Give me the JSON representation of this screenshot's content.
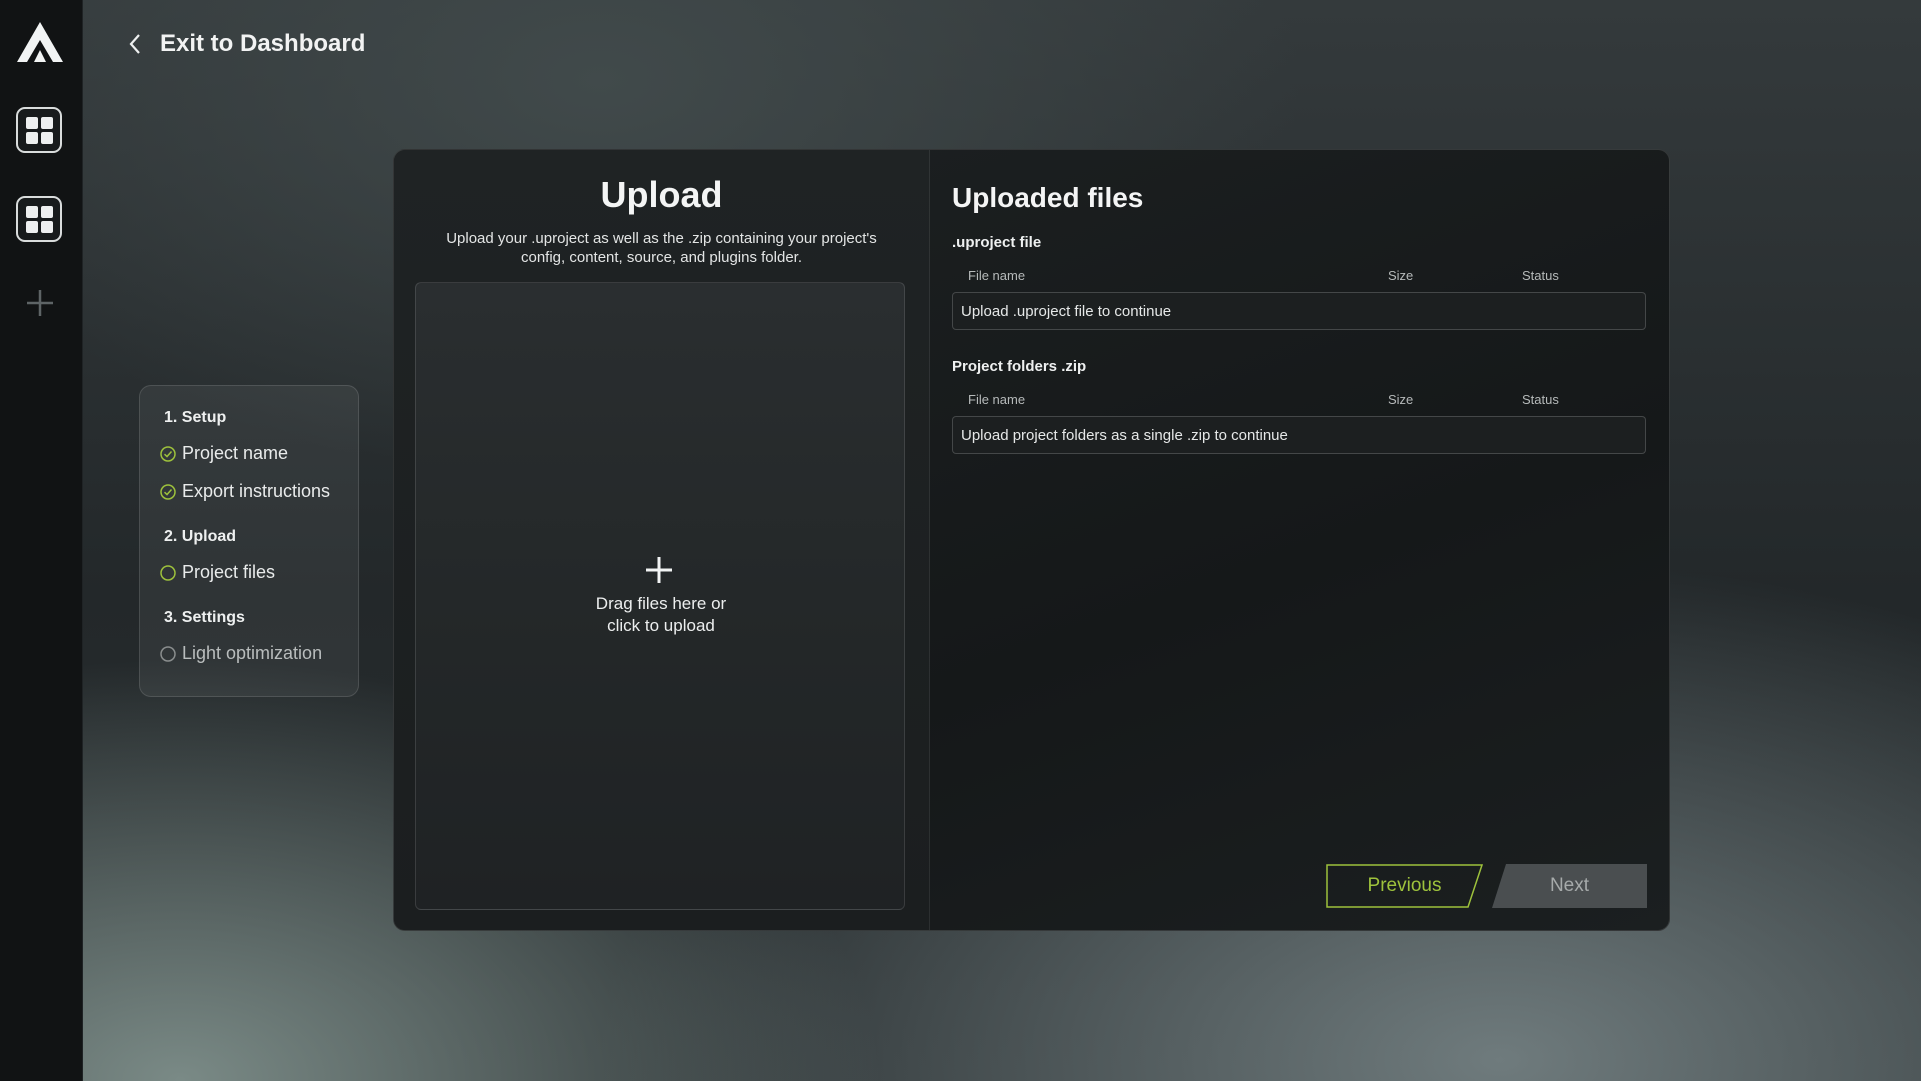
{
  "nav": {
    "back_label": "Exit to Dashboard"
  },
  "steps": {
    "setup": "1. Setup",
    "project_name": "Project name",
    "export_instructions": "Export instructions",
    "upload": "2. Upload",
    "project_files": "Project files",
    "settings": "3. Settings",
    "light_optimization": "Light optimization"
  },
  "upload": {
    "title": "Upload",
    "description": "Upload your .uproject as well as the .zip containing your project's config, content, source, and plugins folder.",
    "drop_line1": "Drag files here or",
    "drop_line2": "click to upload"
  },
  "files": {
    "title": "Uploaded files",
    "uproject": {
      "label": ".uproject file",
      "col_name": "File name",
      "col_size": "Size",
      "col_status": "Status",
      "empty": "Upload .uproject file to continue"
    },
    "zip": {
      "label": "Project folders .zip",
      "col_name": "File name",
      "col_size": "Size",
      "col_status": "Status",
      "empty": "Upload project folders as a single .zip to continue"
    }
  },
  "actions": {
    "previous": "Previous",
    "next": "Next"
  },
  "colors": {
    "accent": "#9ec23c",
    "complete": "#9ec23c",
    "pending": "#8a8e8e"
  },
  "icons": {
    "logo": "logo-icon",
    "dashboard": "grid-icon",
    "add": "plus-icon",
    "back": "chevron-left-icon",
    "step_done": "check-circle-icon",
    "step_current": "circle-icon",
    "step_pending": "circle-icon"
  }
}
